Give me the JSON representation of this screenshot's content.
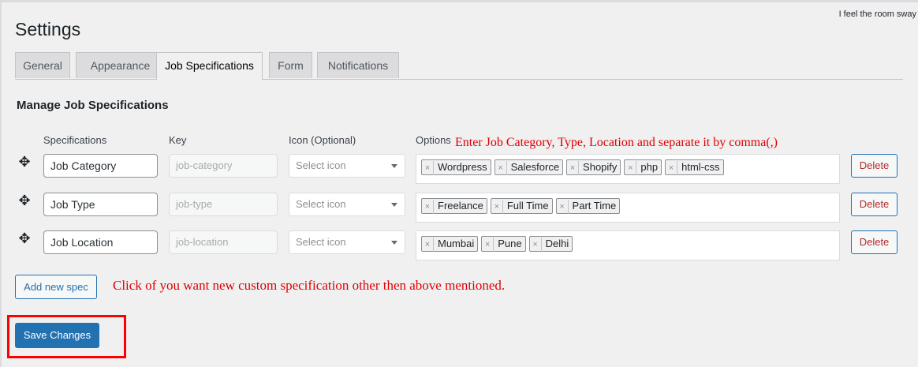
{
  "top_right_text": "I feel the room sway",
  "page_title": "Settings",
  "tabs": [
    {
      "label": "General"
    },
    {
      "label": "Appearance"
    },
    {
      "label": "Job Specifications"
    },
    {
      "label": "Form"
    },
    {
      "label": "Notifications"
    }
  ],
  "active_tab": "Job Specifications",
  "section_title": "Manage Job Specifications",
  "columns": {
    "specifications": "Specifications",
    "key": "Key",
    "icon": "Icon (Optional)",
    "options": "Options"
  },
  "annotations": {
    "options_hint": "Enter Job Category, Type, Location  and separate it by comma(,)",
    "add_hint": "Click of you want new custom specification other then above mentioned."
  },
  "icon_select_placeholder": "Select icon",
  "rows": [
    {
      "spec": "Job Category",
      "key": "job-category",
      "options": [
        "Wordpress",
        "Salesforce",
        "Shopify",
        "php",
        "html-css"
      ]
    },
    {
      "spec": "Job Type",
      "key": "job-type",
      "options": [
        "Freelance",
        "Full Time",
        "Part Time"
      ]
    },
    {
      "spec": "Job Location",
      "key": "job-location",
      "options": [
        "Mumbai",
        "Pune",
        "Delhi"
      ]
    }
  ],
  "buttons": {
    "delete": "Delete",
    "add_new_spec": "Add new spec",
    "save_changes": "Save Changes"
  },
  "colors": {
    "primary": "#2271b1",
    "delete": "#b32d2e",
    "annotation": "#e00000"
  }
}
